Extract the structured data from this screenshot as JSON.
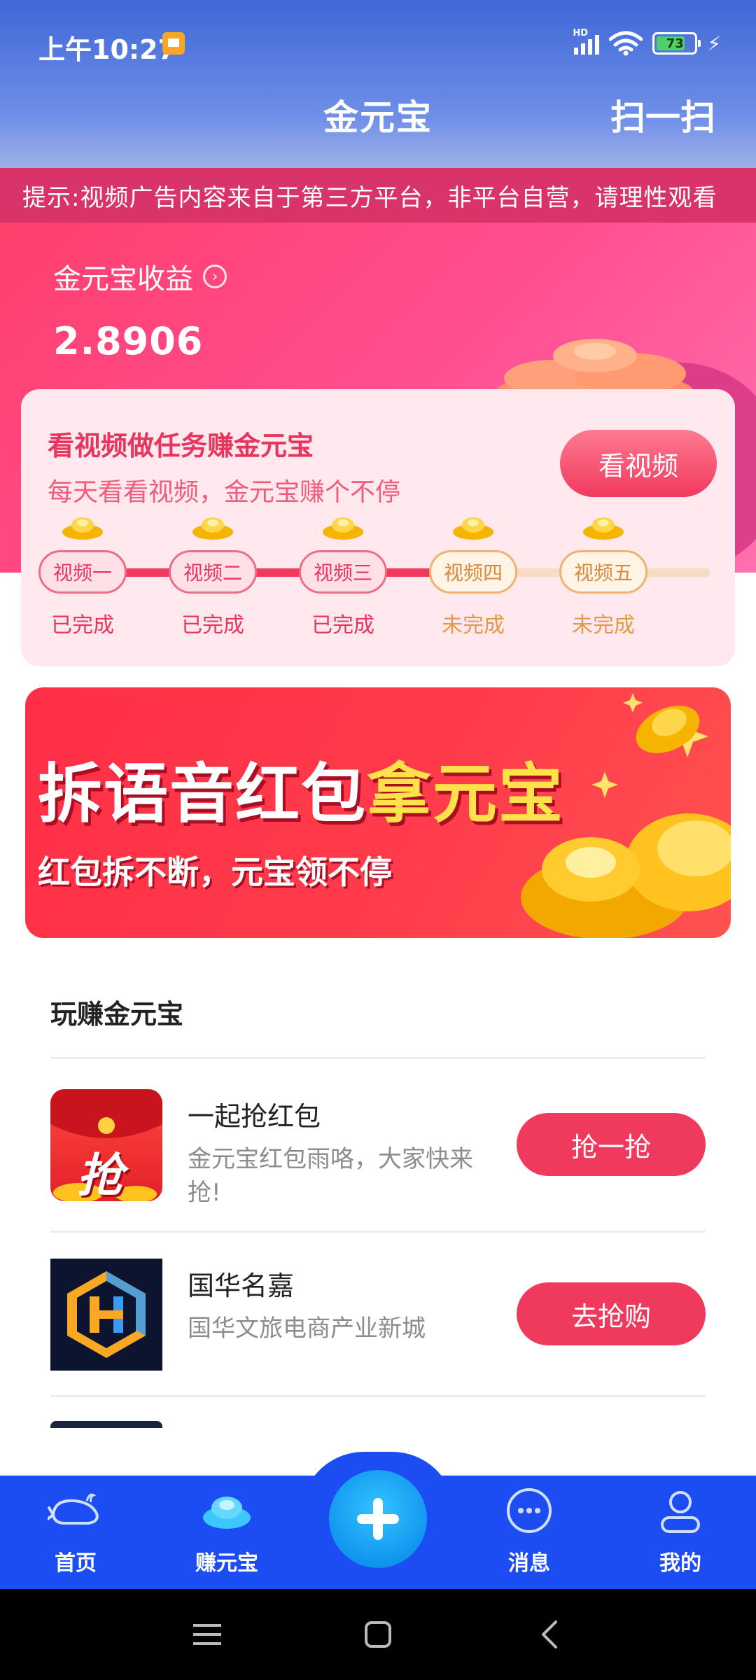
{
  "status_bar": {
    "time": "上午10:27",
    "network_label": "HD",
    "battery": "73"
  },
  "header": {
    "title": "金元宝",
    "scan_label": "扫一扫"
  },
  "notice": {
    "text": "提示:视频广告内容来自于第三方平台，非平台自营，请理性观看"
  },
  "earnings": {
    "title": "金元宝收益",
    "value": "2.8906"
  },
  "task_card": {
    "title": "看视频做任务赚金元宝",
    "subtitle": "每天看看视频，金元宝赚个不停",
    "button_label": "看视频",
    "steps": [
      {
        "label": "视频一",
        "state": "已完成"
      },
      {
        "label": "视频二",
        "state": "已完成"
      },
      {
        "label": "视频三",
        "state": "已完成"
      },
      {
        "label": "视频四",
        "state": "未完成"
      },
      {
        "label": "视频五",
        "state": "未完成"
      }
    ],
    "completed_count": 3
  },
  "banner": {
    "headline_white": "拆语音红包",
    "headline_yellow": "拿元宝",
    "subline": "红包拆不断，元宝领不停"
  },
  "section": {
    "title": "玩赚金元宝",
    "items": [
      {
        "name": "一起抢红包",
        "desc": "金元宝红包雨咯，大家快来抢!",
        "action": "抢一抢",
        "icon": "red-envelope-icon",
        "icon_text": "抢"
      },
      {
        "name": "国华名嘉",
        "desc": "国华文旅电商产业新城",
        "action": "去抢购",
        "icon": "hexagon-h-logo-icon"
      }
    ]
  },
  "tabbar": {
    "tabs": [
      {
        "label": "首页",
        "icon": "whale-icon"
      },
      {
        "label": "赚元宝",
        "icon": "ingot-icon"
      },
      {
        "label": "消息",
        "icon": "chat-bubble-icon"
      },
      {
        "label": "我的",
        "icon": "person-icon"
      }
    ],
    "center_icon": "plus-icon"
  },
  "colors": {
    "header_blue": "#3f67d6",
    "accent_pink": "#ef3a5d",
    "tab_blue": "#1c4df2",
    "gold": "#ffc53a"
  }
}
